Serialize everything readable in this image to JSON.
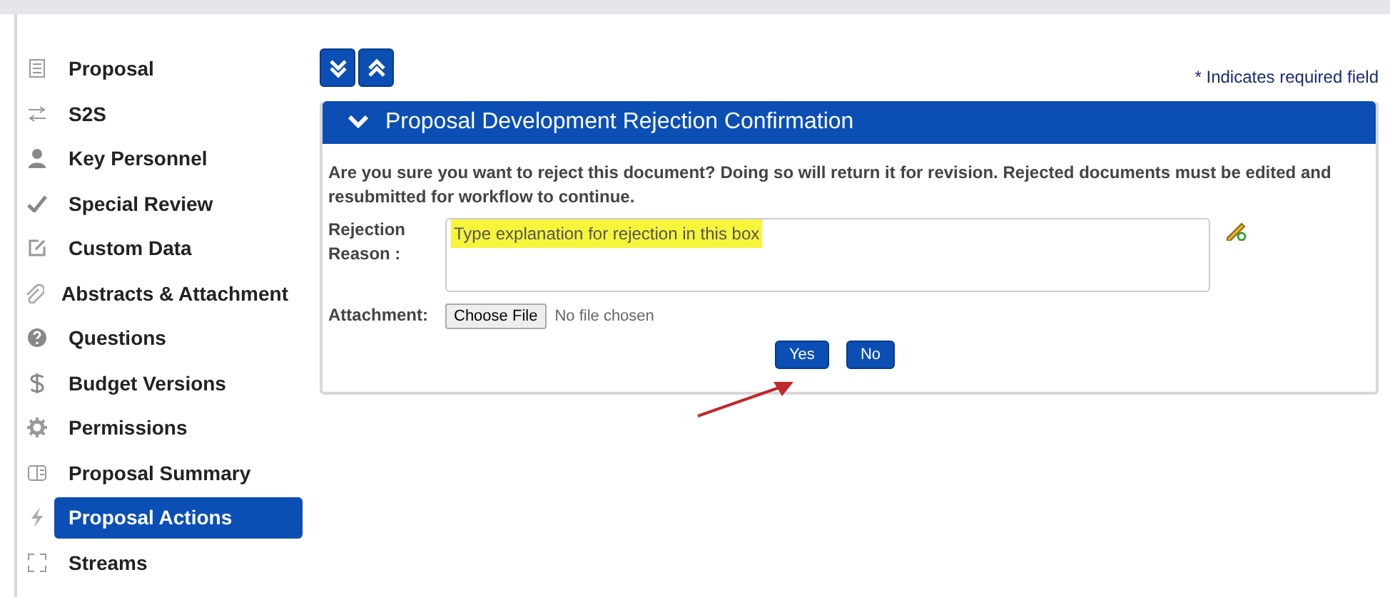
{
  "sidebar": {
    "items": [
      {
        "label": "Proposal",
        "selected": false
      },
      {
        "label": "S2S",
        "selected": false
      },
      {
        "label": "Key Personnel",
        "selected": false
      },
      {
        "label": "Special Review",
        "selected": false
      },
      {
        "label": "Custom Data",
        "selected": false
      },
      {
        "label": "Abstracts & Attachment",
        "selected": false
      },
      {
        "label": "Questions",
        "selected": false
      },
      {
        "label": "Budget Versions",
        "selected": false
      },
      {
        "label": "Permissions",
        "selected": false
      },
      {
        "label": "Proposal Summary",
        "selected": false
      },
      {
        "label": "Proposal Actions",
        "selected": true
      },
      {
        "label": "Streams",
        "selected": false
      }
    ]
  },
  "required_note": "* Indicates required field",
  "panel": {
    "title": "Proposal Development Rejection Confirmation",
    "expanded": true,
    "message": "Are you sure you want to reject this document? Doing so will return it for revision. Rejected documents must be edited and resubmitted for workflow to continue.",
    "reason_label": "Rejection Reason :",
    "reason_value": "Type explanation for rejection in this box",
    "attachment_label": "Attachment:",
    "file_button": "Choose File",
    "file_status": "No file chosen",
    "buttons": [
      "Yes",
      "No"
    ]
  }
}
